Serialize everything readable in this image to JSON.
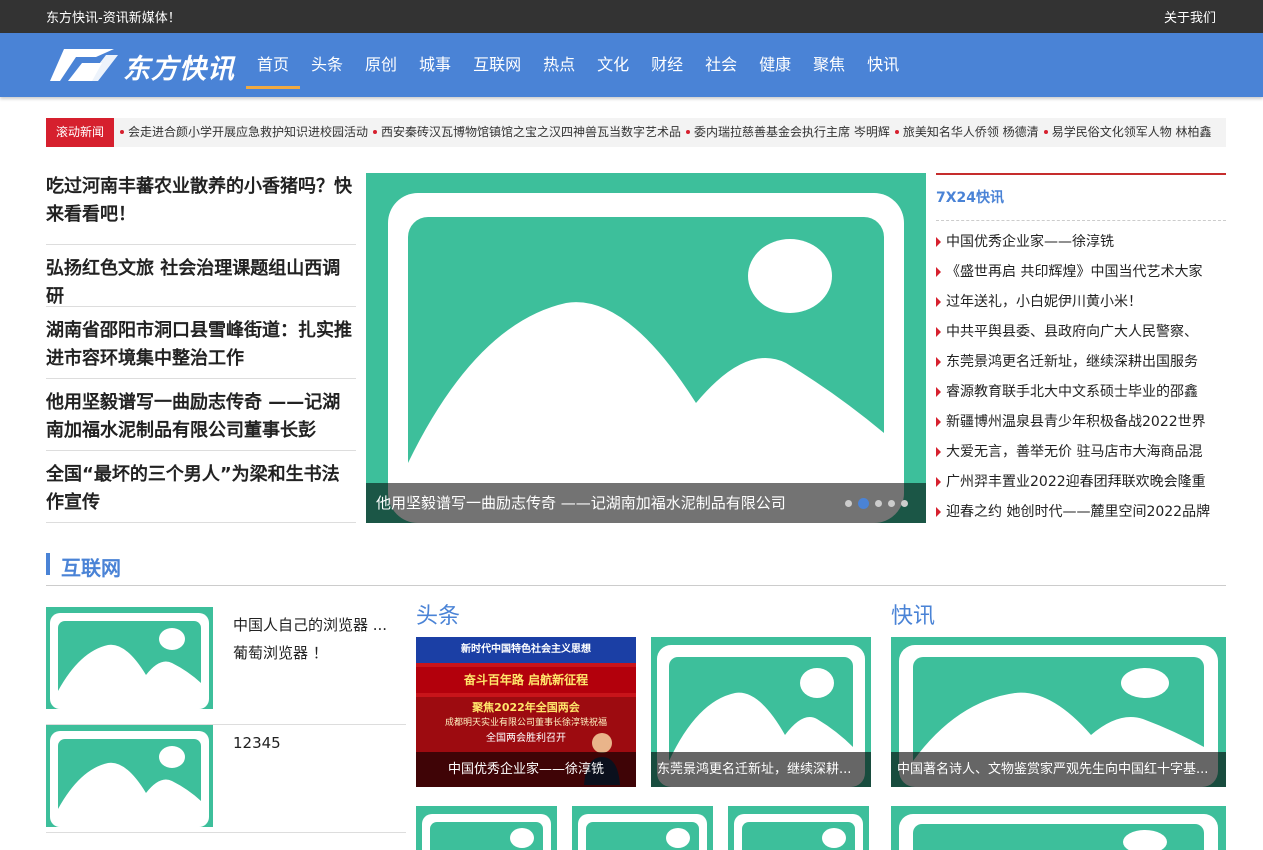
{
  "topbar": {
    "slogan": "东方快讯-资讯新媒体！",
    "about": "关于我们"
  },
  "logo": {
    "text": "东方快讯"
  },
  "nav": {
    "items": [
      {
        "label": "首页",
        "active": true
      },
      {
        "label": "头条"
      },
      {
        "label": "原创"
      },
      {
        "label": "城事"
      },
      {
        "label": "互联网"
      },
      {
        "label": "热点"
      },
      {
        "label": "文化"
      },
      {
        "label": "财经"
      },
      {
        "label": "社会"
      },
      {
        "label": "健康"
      },
      {
        "label": "聚焦"
      },
      {
        "label": "快讯"
      }
    ]
  },
  "ticker": {
    "tag": "滚动新闻",
    "items": [
      "会走进合颜小学开展应急救护知识进校园活动",
      "西安秦砖汉瓦博物馆镇馆之宝之汉四神兽瓦当数字艺术品",
      "委内瑞拉慈善基金会执行主席 岑明辉",
      "旅美知名华人侨领 杨德清",
      "易学民俗文化领军人物 林柏鑫"
    ]
  },
  "headlines": [
    {
      "line1": "吃过河南丰蕃农业散养的小香猪吗？快",
      "line2": "来看看吧！"
    },
    {
      "line1": "弘扬红色文旅 社会治理课题组山西调",
      "line2": "研"
    },
    {
      "line1": "湖南省邵阳市洞口县雪峰街道：扎实推",
      "line2": "进市容环境集中整治工作"
    },
    {
      "line1": "他用坚毅谱写一曲励志传奇 ——记湖",
      "line2": "南加福水泥制品有限公司董事长彭"
    },
    {
      "line1": "全国“最坏的三个男人”为梁和生书法",
      "line2": "作宣传"
    }
  ],
  "carousel": {
    "caption": "他用坚毅谱写一曲励志传奇 ——记湖南加福水泥制品有限公司",
    "dot_count": 5,
    "active_dot": 2
  },
  "flash": {
    "title": "7X24快讯",
    "items": [
      "中国优秀企业家——徐淳铣",
      "《盛世再启 共印辉煌》中国当代艺术大家",
      "过年送礼，小白妮伊川黄小米！",
      "中共平舆县委、县政府向广大人民警察、",
      "东莞景鸿更名迁新址，继续深耕出国服务",
      "睿源教育联手北大中文系硕士毕业的邵鑫",
      "新疆博州温泉县青少年积极备战2022世界",
      "大爱无言，善举无价 驻马店市大海商品混",
      "广州羿丰置业2022迎春团拜联欢晚会隆重",
      "迎春之约 她创时代——麓里空间2022品牌"
    ]
  },
  "section": {
    "name": "互联网",
    "list": [
      {
        "line1": "中国人自己的浏览器 ...",
        "line2": "葡萄浏览器 ！"
      },
      {
        "line1": "12345",
        "line2": ""
      }
    ],
    "toutiao": {
      "heading": "头条",
      "cards": [
        {
          "caption": "中国优秀企业家——徐淳铣"
        },
        {
          "caption": "东莞景鸿更名迁新址，继续深耕..."
        }
      ],
      "banner": {
        "line1": "新时代中国特色社会主义思想",
        "line2": "奋斗百年路 启航新征程",
        "line3": "聚焦2022年全国两会",
        "line4": "成都明天实业有限公司董事长徐淳铣祝福",
        "line5": "全国两会胜利召开"
      }
    },
    "kuaixun": {
      "heading": "快讯",
      "cards": [
        {
          "caption": "中国著名诗人、文物鉴赏家严观先生向中国红十字基..."
        }
      ]
    }
  },
  "colors": {
    "accent_blue": "#4a83d6",
    "placeholder_green": "#3dbf9b",
    "ticker_red": "#d6202e",
    "top_bar": "#333333"
  }
}
